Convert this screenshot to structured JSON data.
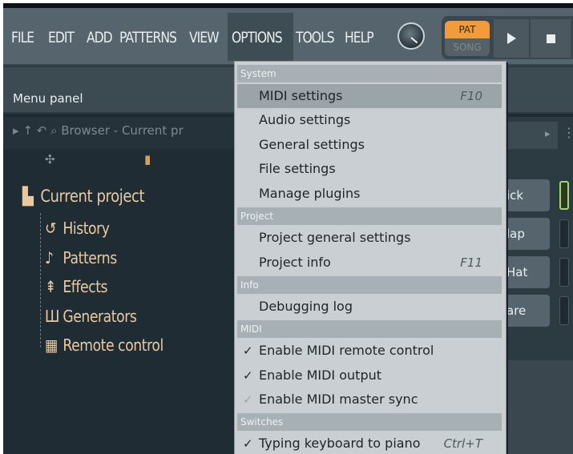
{
  "menubar": {
    "items": [
      "FILE",
      "EDIT",
      "ADD",
      "PATTERNS",
      "VIEW",
      "OPTIONS",
      "TOOLS",
      "HELP"
    ],
    "active": "OPTIONS"
  },
  "transport": {
    "pat_label": "PAT",
    "song_label": "SONG"
  },
  "panel": {
    "title": "Menu panel"
  },
  "browser": {
    "label": "Browser - Current pr",
    "tree": [
      {
        "label": "Current project",
        "icon": "folder-icon",
        "glyph": "▙"
      },
      {
        "label": "History",
        "icon": "history-icon",
        "glyph": "↺"
      },
      {
        "label": "Patterns",
        "icon": "note-icon",
        "glyph": "♪"
      },
      {
        "label": "Effects",
        "icon": "effects-icon",
        "glyph": "⇞"
      },
      {
        "label": "Generators",
        "icon": "piano-icon",
        "glyph": "Ш"
      },
      {
        "label": "Remote control",
        "icon": "remote-icon",
        "glyph": "▦"
      }
    ]
  },
  "channels": [
    "ick",
    "lap",
    "Hat",
    "are"
  ],
  "dropdown": {
    "sections": [
      {
        "title": "System"
      },
      {
        "title": "Project"
      },
      {
        "title": "Info"
      },
      {
        "title": "MIDI"
      },
      {
        "title": "Switches"
      }
    ],
    "items": [
      {
        "label": "MIDI settings",
        "shortcut": "F10",
        "highlighted": true
      },
      {
        "label": "Audio settings",
        "shortcut": ""
      },
      {
        "label": "General settings",
        "shortcut": ""
      },
      {
        "label": "File settings",
        "shortcut": ""
      },
      {
        "label": "Manage plugins",
        "shortcut": ""
      },
      {
        "label": "Project general settings",
        "shortcut": ""
      },
      {
        "label": "Project info",
        "shortcut": "F11"
      },
      {
        "label": "Debugging log",
        "shortcut": ""
      },
      {
        "label": "Enable MIDI remote control",
        "shortcut": "",
        "checked": true
      },
      {
        "label": "Enable MIDI output",
        "shortcut": "",
        "checked": true
      },
      {
        "label": "Enable MIDI master sync",
        "shortcut": "",
        "checked": false
      },
      {
        "label": "Typing keyboard to piano",
        "shortcut": "Ctrl+T",
        "checked": true
      }
    ]
  },
  "colors": {
    "accent_orange": "#f39a3a",
    "led_green": "#9fd86a",
    "menu_bg": "#c9cfd2"
  }
}
